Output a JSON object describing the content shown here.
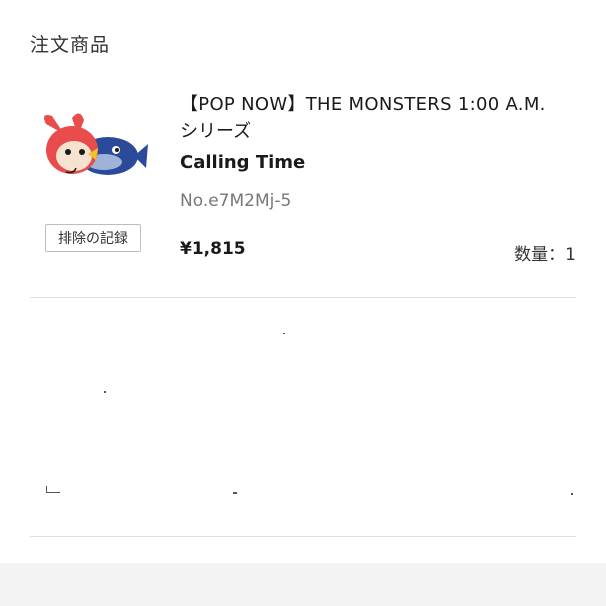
{
  "order": {
    "section_title": "注文商品",
    "item": {
      "name_line1": "【POP NOW】THE MONSTERS 1:00 A.M.",
      "name_line2": "シリーズ",
      "variant": "Calling Time",
      "sku": "No.e7M2Mj-5",
      "price": "¥1,815",
      "quantity_label": "数量：1",
      "exclude_button": "排除の記録",
      "thumbnail_icon": "figure-thumbnail"
    }
  },
  "colors": {
    "text_primary": "#1a1a1a",
    "text_secondary": "#777777",
    "divider": "#e0e0e0",
    "bunny_red": "#e84c4c",
    "fish_blue": "#2c4a9a"
  }
}
